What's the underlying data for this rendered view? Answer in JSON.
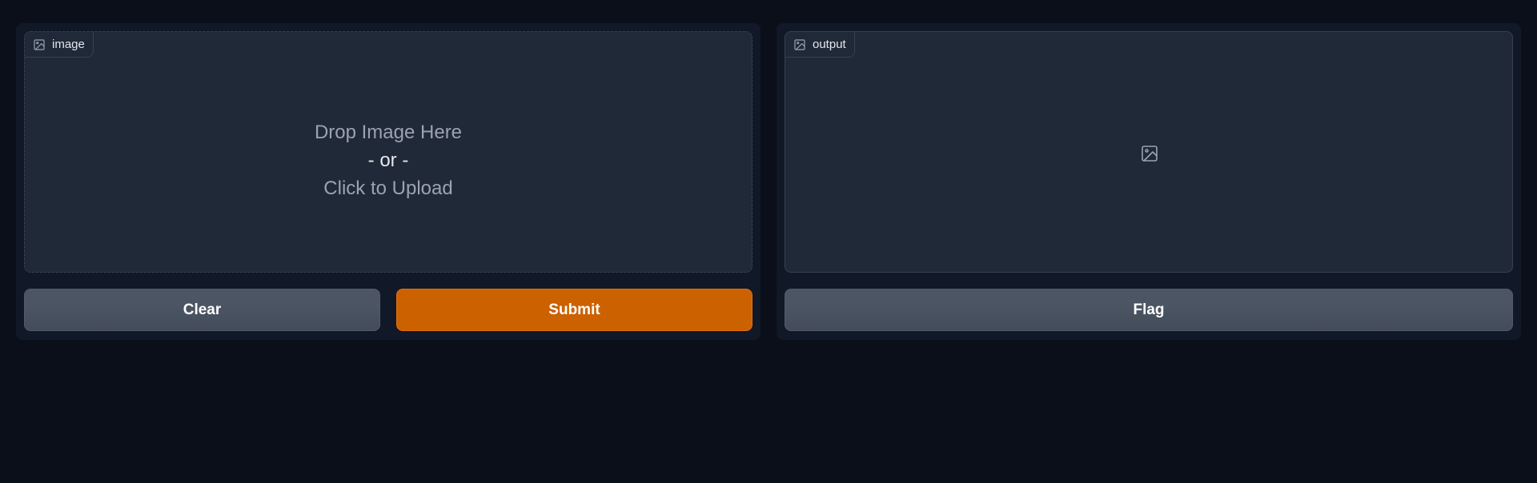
{
  "input": {
    "label": "image",
    "label_icon": "image-icon",
    "drop_line1": "Drop Image Here",
    "drop_line2": "- or -",
    "drop_line3": "Click to Upload"
  },
  "output": {
    "label": "output",
    "label_icon": "image-icon",
    "placeholder_icon": "image-icon"
  },
  "buttons": {
    "clear": "Clear",
    "submit": "Submit",
    "flag": "Flag"
  },
  "colors": {
    "background": "#0b0f19",
    "panel": "#111827",
    "block": "#1f2937",
    "primary": "#cc6100",
    "secondary": "#4b5563"
  }
}
